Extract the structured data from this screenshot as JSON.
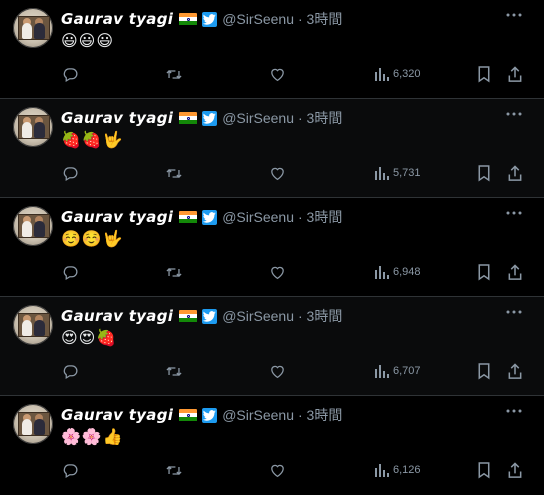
{
  "colors": {
    "background": "#000000",
    "text": "#e7e9ea",
    "muted": "#8b98a5",
    "verified": "#1d9bf0",
    "divider": "#2f3336"
  },
  "tweets": [
    {
      "name": "Gaurav tyagi",
      "handle": "@SirSeenu",
      "time": "· 3時間",
      "text": "😃😃😃",
      "views": "6,320"
    },
    {
      "name": "Gaurav tyagi",
      "handle": "@SirSeenu",
      "time": "· 3時間",
      "text": "🍓🍓🤟",
      "views": "5,731"
    },
    {
      "name": "Gaurav tyagi",
      "handle": "@SirSeenu",
      "time": "· 3時間",
      "text": "☺️☺️🤟",
      "views": "6,948"
    },
    {
      "name": "Gaurav tyagi",
      "handle": "@SirSeenu",
      "time": "· 3時間",
      "text": "😍😍🍓",
      "views": "6,707"
    },
    {
      "name": "Gaurav tyagi",
      "handle": "@SirSeenu",
      "time": "· 3時間",
      "text": "🌸🌸👍",
      "views": "6,126"
    }
  ],
  "icons": {
    "avatar": "avatar-photo",
    "flag": "india-flag-icon",
    "verified": "verified-badge-icon",
    "more": "more-icon",
    "reply": "reply-icon",
    "retweet": "retweet-icon",
    "like": "like-icon",
    "views": "views-icon",
    "bookmark": "bookmark-icon",
    "share": "share-icon"
  }
}
